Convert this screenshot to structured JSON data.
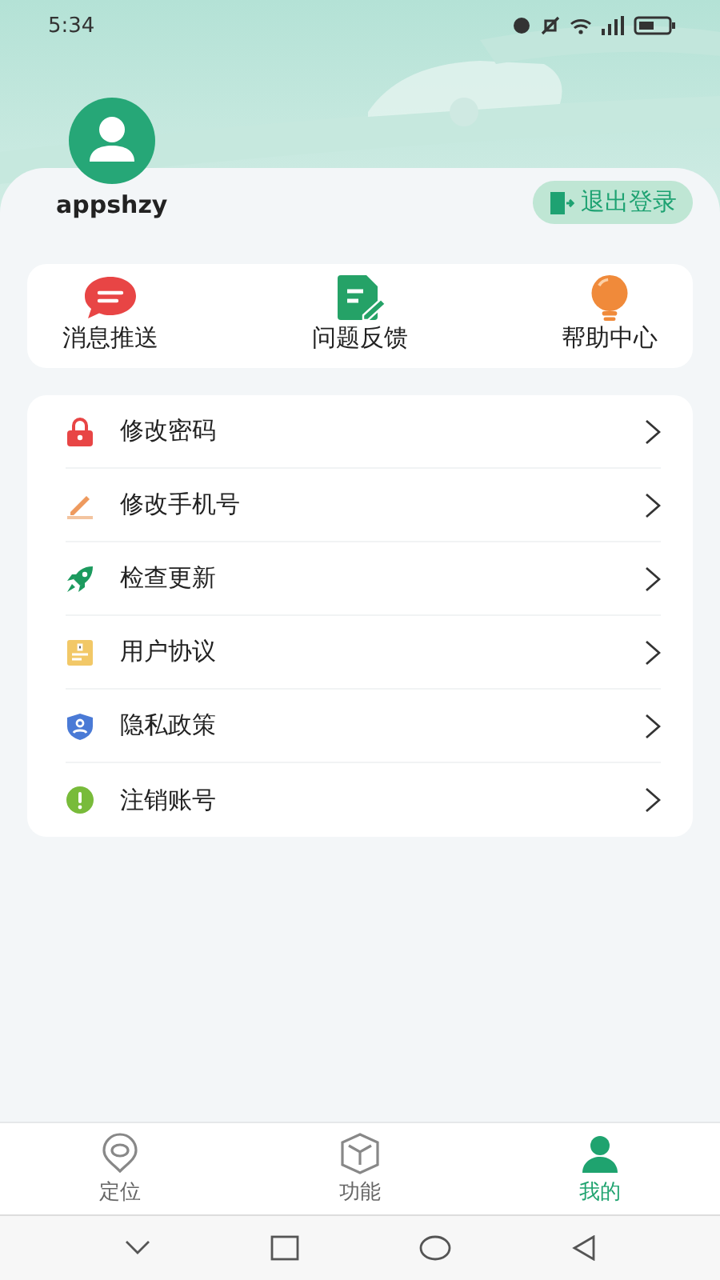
{
  "status_bar": {
    "time": "5:34"
  },
  "profile": {
    "username": "appshzy",
    "logout": "退出登录"
  },
  "quick_actions": [
    {
      "kind": "message",
      "label": "消息推送"
    },
    {
      "kind": "feedback",
      "label": "问题反馈"
    },
    {
      "kind": "help",
      "label": "帮助中心"
    }
  ],
  "menu": [
    {
      "kind": "lock",
      "label": "修改密码"
    },
    {
      "kind": "pencil",
      "label": "修改手机号"
    },
    {
      "kind": "rocket",
      "label": "检查更新"
    },
    {
      "kind": "document",
      "label": "用户协议"
    },
    {
      "kind": "shield",
      "label": "隐私政策"
    },
    {
      "kind": "alert",
      "label": "注销账号"
    }
  ],
  "tabs": [
    {
      "kind": "location",
      "label": "定位",
      "selected": false
    },
    {
      "kind": "cube",
      "label": "功能",
      "selected": false
    },
    {
      "kind": "person",
      "label": "我的",
      "selected": true
    }
  ]
}
